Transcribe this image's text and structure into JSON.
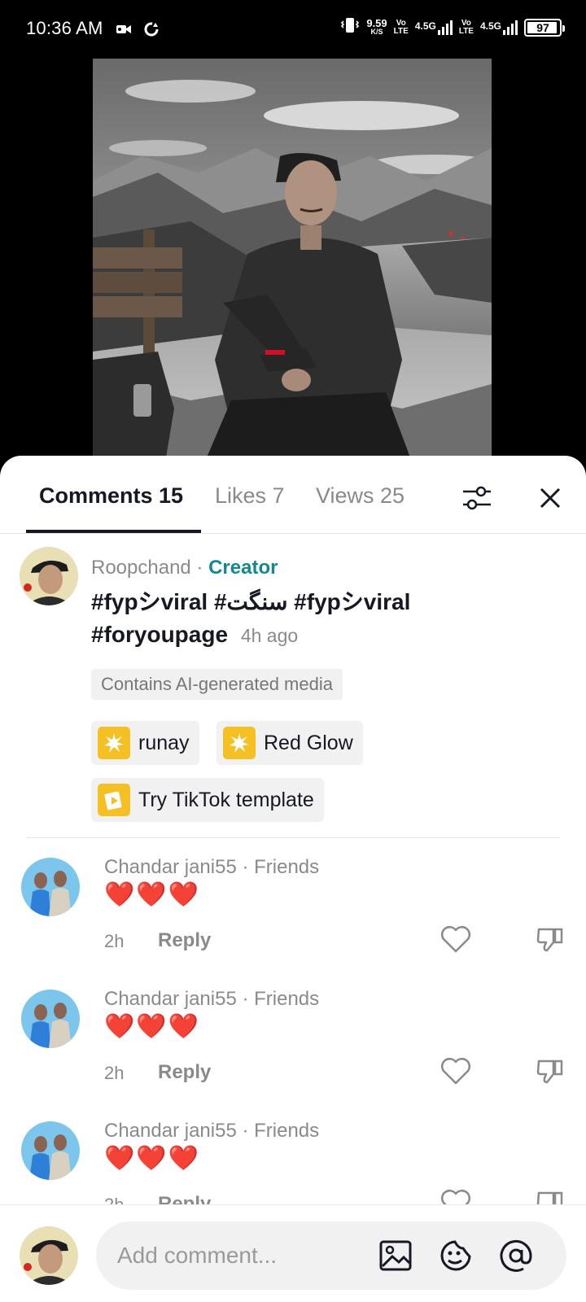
{
  "status_bar": {
    "time": "10:36 AM",
    "speed_value": "9.59",
    "speed_unit": "K/S",
    "sim1_label_top": "Vo",
    "sim1_label_bottom": "LTE",
    "sim1_network": "4.5G",
    "sim2_label_top": "Vo",
    "sim2_label_bottom": "LTE",
    "sim2_network": "4.5G",
    "battery": "97"
  },
  "tabs": {
    "comments": "Comments 15",
    "likes": "Likes 7",
    "views": "Views 25"
  },
  "creator_post": {
    "name": "Roopchand",
    "separator": " · ",
    "tag": "Creator",
    "caption": "#fypシviral #سنگت #fypシviral #foryoupage",
    "time": "4h ago",
    "ai_label": "Contains AI-generated media",
    "effects": [
      {
        "label": "runay"
      },
      {
        "label": "Red Glow"
      }
    ],
    "template_label": "Try TikTok template"
  },
  "comments": [
    {
      "name": "Chandar jani55 · Friends",
      "text": "❤️❤️❤️",
      "time": "2h",
      "reply": "Reply"
    },
    {
      "name": "Chandar jani55 · Friends",
      "text": "❤️❤️❤️",
      "time": "2h",
      "reply": "Reply"
    },
    {
      "name": "Chandar jani55 · Friends",
      "text": "❤️❤️❤️",
      "time": "2h",
      "reply": "Reply"
    }
  ],
  "composer": {
    "placeholder": "Add comment..."
  },
  "colors": {
    "creator_accent": "#12888f",
    "effect_icon": "#f5c024"
  },
  "icons": [
    "video-camera-icon",
    "sync-icon",
    "vibrate-icon",
    "filter-icon",
    "close-icon",
    "heart-icon",
    "dislike-icon",
    "image-icon",
    "emoji-icon",
    "mention-icon"
  ]
}
